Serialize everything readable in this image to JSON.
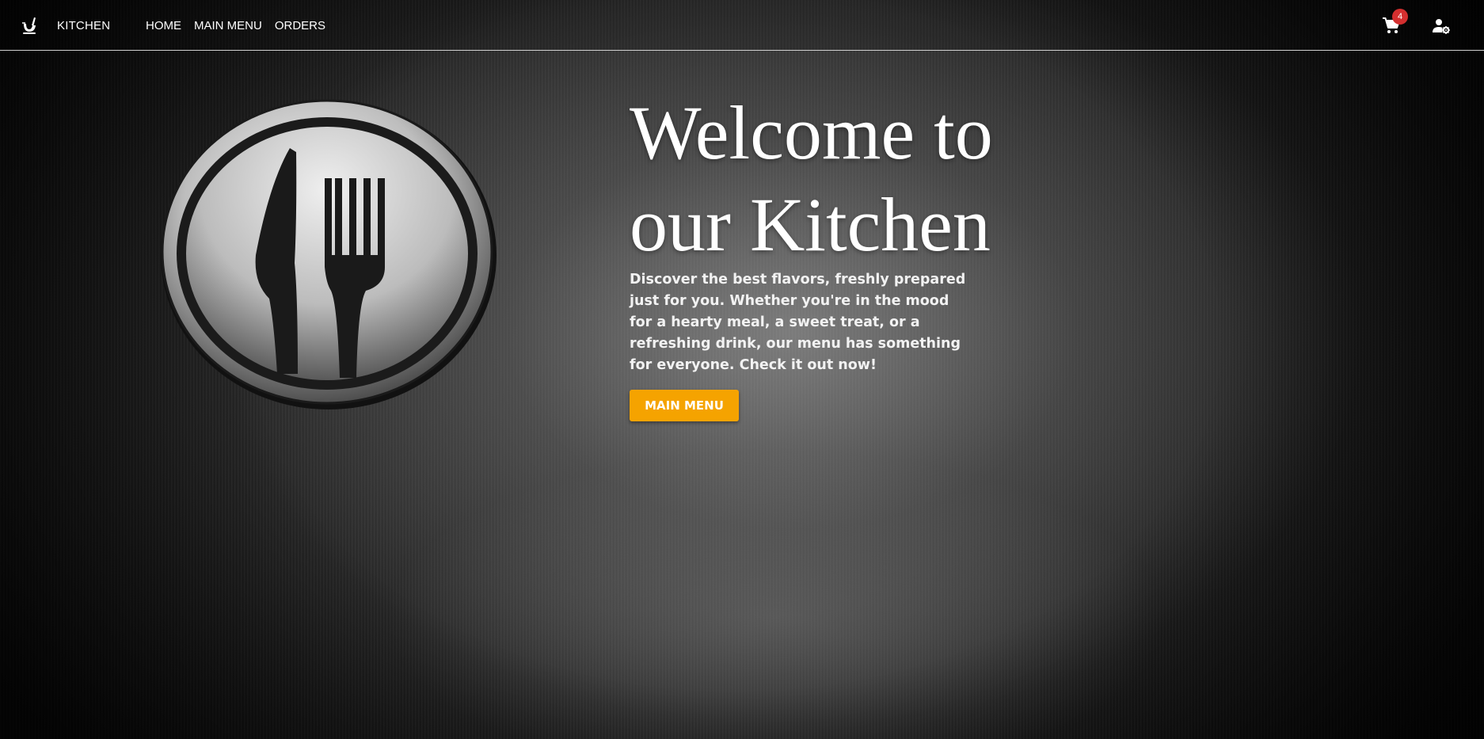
{
  "navbar": {
    "brand": "KITCHEN",
    "brand_icon": "kitchen-utensil-icon",
    "links": [
      "HOME",
      "MAIN MENU",
      "ORDERS"
    ],
    "cart_icon": "cart-icon",
    "cart_count": "4",
    "user_icon": "user-settings-icon"
  },
  "hero": {
    "logo": "knife-fork-plate-logo",
    "title": "Welcome to our Kitchen",
    "description": "Discover the best flavors, freshly prepared just for you. Whether you're in the mood for a hearty meal, a sweet treat, or a refreshing drink, our menu has something for everyone. Check it out now!",
    "button_label": "MAIN MENU"
  },
  "colors": {
    "accent": "#f5a300",
    "badge": "#d32f2f",
    "text": "#ffffff"
  }
}
